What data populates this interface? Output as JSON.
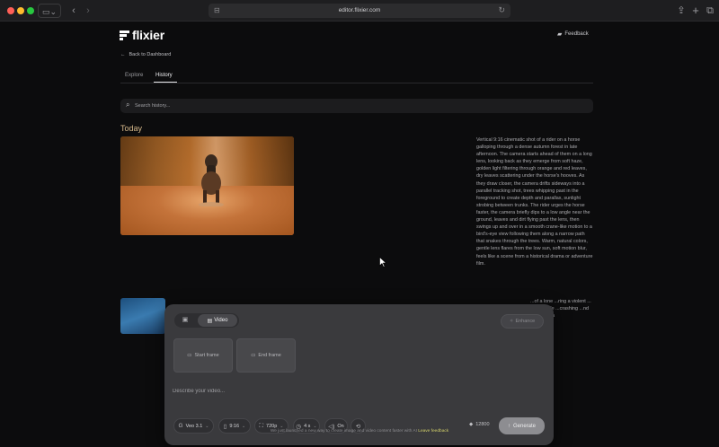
{
  "browser": {
    "url": "editor.flixier.com"
  },
  "header": {
    "logo_text": "flixier",
    "feedback_label": "Feedback",
    "back_label": "Back to Dashboard"
  },
  "tabs": [
    {
      "label": "Explore",
      "active": false
    },
    {
      "label": "History",
      "active": true
    }
  ],
  "search": {
    "placeholder": "Search history..."
  },
  "history": {
    "section_title": "Today",
    "items": [
      {
        "description": "Vertical 9:16 cinematic shot of a rider on a horse galloping through a dense autumn forest in late afternoon. The camera starts ahead of them on a long lens, looking back as they emerge from soft haze, golden light filtering through orange and red leaves, dry leaves scattering under the horse's hooves. As they draw closer, the camera drifts sideways into a parallel tracking shot, trees whipping past in the foreground to create depth and parallax, sunlight strobing between trunks. The rider urges the horse faster, the camera briefly dips to a low angle near the ground, leaves and dirt flying past the lens, then swings up and over in a smooth crane-like motion to a bird's-eye view following them along a narrow path that snakes through the trees. Warm, natural colors, gentle lens flares from the low sun, soft motion blur, feels like a scene from a historical drama or adventure film."
      },
      {
        "description": "...of a lone ...ring a violent ... with a wide ...crashing ...nd the cliff in a"
      }
    ]
  },
  "composer": {
    "mode_video_label": "Video",
    "enhance_label": "Enhance",
    "start_frame_label": "Start frame",
    "end_frame_label": "End frame",
    "prompt_placeholder": "Describe your video...",
    "model_label": "Veo 3.1",
    "aspect_label": "9:16",
    "resolution_label": "720p",
    "duration_label": "4 s",
    "audio_label": "On",
    "credits_value": "12800",
    "generate_label": "Generate"
  },
  "footer": {
    "text": "We just launched a new way to create image and video content faster with AI",
    "link_label": "Leave feedback"
  },
  "colors": {
    "background": "#0c0c0d",
    "panel": "#3a3a3d",
    "section_title": "#d6b88a",
    "footer_link": "#d2d06a"
  }
}
